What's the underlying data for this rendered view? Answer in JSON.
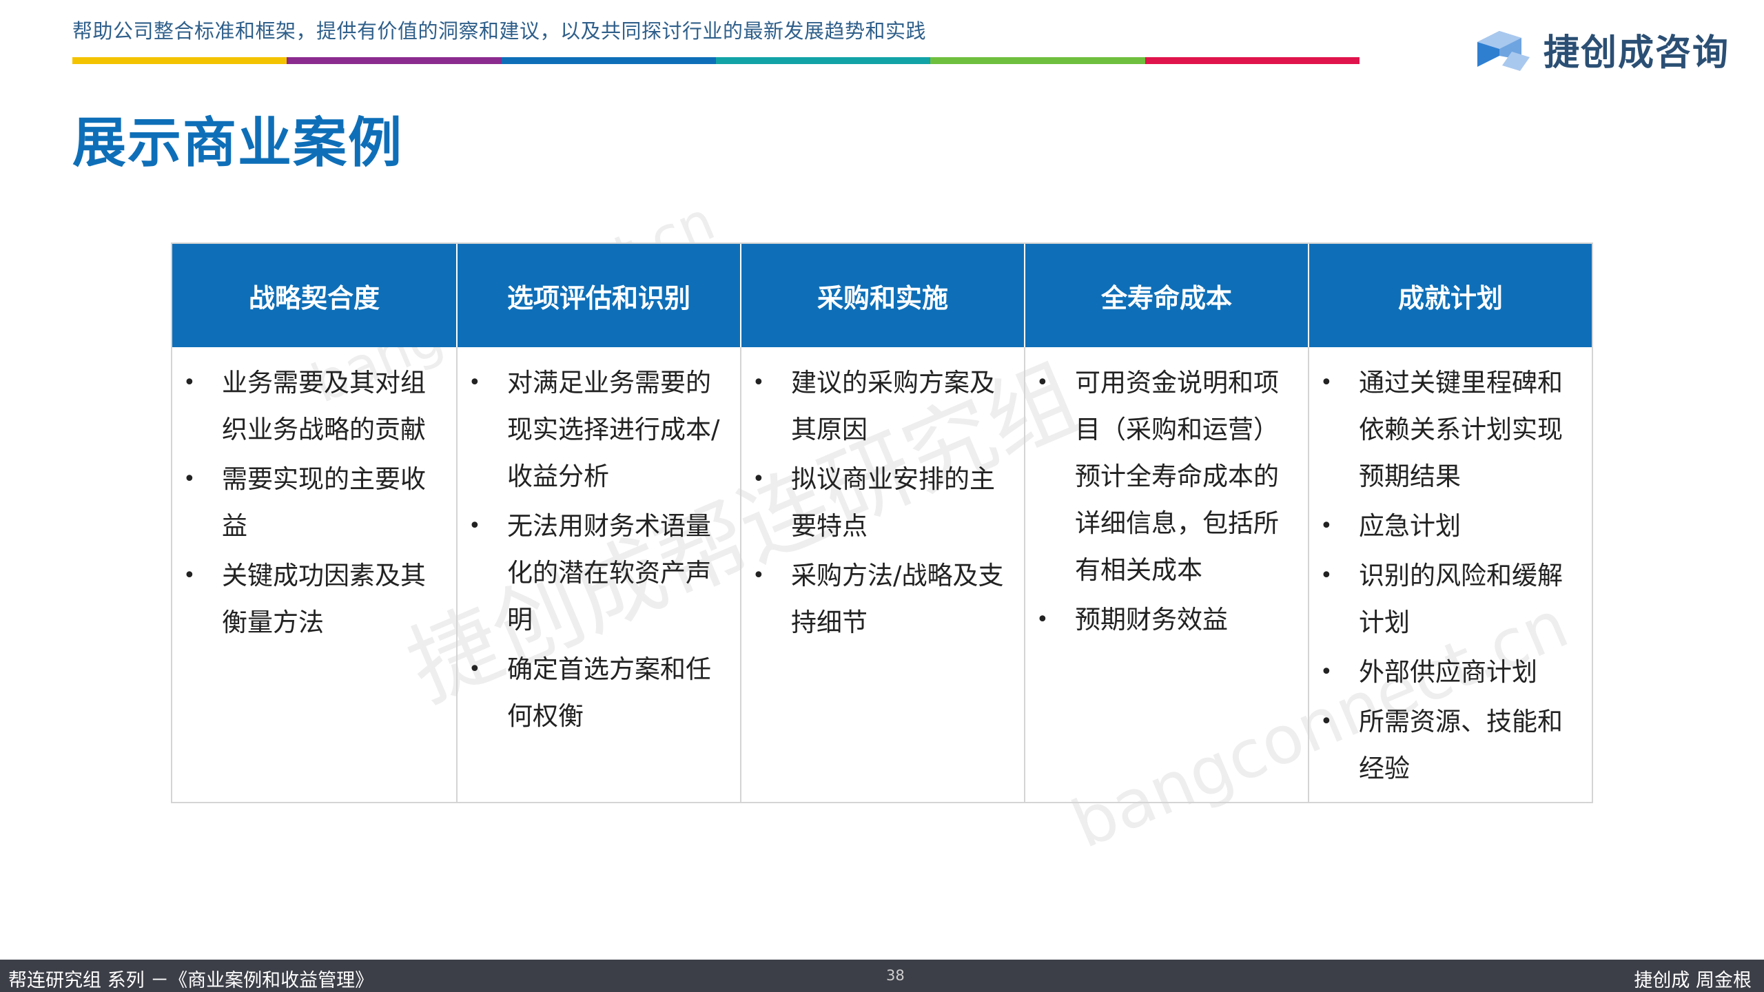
{
  "header": {
    "tagline": "帮助公司整合标准和框架，提供有价值的洞察和建议，以及共同探讨行业的最新发展趋势和实践",
    "color_stripes": [
      "#f4c300",
      "#8b2b8f",
      "#0e6fb8",
      "#12a3a6",
      "#6fbf3f",
      "#e0144c"
    ],
    "logo": {
      "icon": "cube-logo-icon",
      "text": "捷创成咨询",
      "colors": [
        "#2f7fd1",
        "#6ea4e0",
        "#a9c8ee"
      ]
    }
  },
  "page_title": "展示商业案例",
  "columns": [
    {
      "title": "战略契合度",
      "bullets": [
        "业务需要及其对组织业务战略的贡献",
        "需要实现的主要收益",
        "关键成功因素及其衡量方法"
      ]
    },
    {
      "title": "选项评估和识别",
      "bullets": [
        "对满足业务需要的现实选择进行成本/收益分析",
        "无法用财务术语量化的潜在软资产声明",
        "确定首选方案和任何权衡"
      ]
    },
    {
      "title": "采购和实施",
      "bullets": [
        "建议的采购方案及其原因",
        "拟议商业安排的主要特点",
        "采购方法/战略及支持细节"
      ]
    },
    {
      "title": "全寿命成本",
      "bullets": [
        "可用资金说明和项目（采购和运营）预计全寿命成本的详细信息，包括所有相关成本",
        "预期财务效益"
      ]
    },
    {
      "title": "成就计划",
      "bullets": [
        "通过关键里程碑和依赖关系计划实现预期结果",
        "应急计划",
        "识别的风险和缓解计划",
        "外部供应商计划",
        "所需资源、技能和经验"
      ]
    }
  ],
  "bullet_symbol": "•",
  "watermarks": [
    "捷创成帮连研究组",
    "bangconnect.cn",
    "bangconnect.cn"
  ],
  "footer": {
    "left": "帮连研究组 系列 －《商业案例和收益管理》",
    "page_number": "38",
    "right": "捷创成 周金根"
  },
  "colors": {
    "accent_blue": "#0e6fb8",
    "footer_bg": "#3d3f48"
  }
}
